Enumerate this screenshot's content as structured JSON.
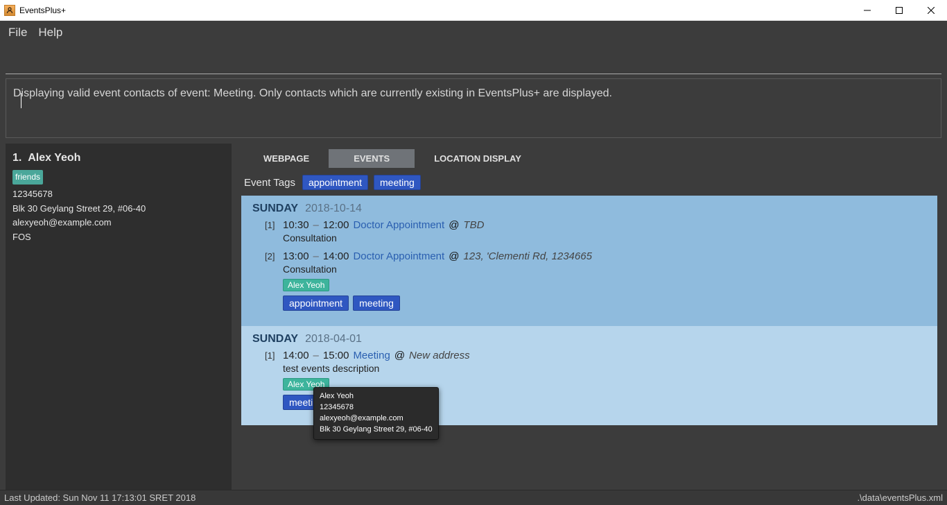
{
  "window": {
    "title": "EventsPlus+"
  },
  "menu": {
    "file": "File",
    "help": "Help"
  },
  "command": {
    "value": "",
    "placeholder": ""
  },
  "message": "Displaying valid event contacts of event: Meeting. Only contacts which are currently existing in EventsPlus+ are displayed.",
  "contact": {
    "index": "1.",
    "name": "Alex Yeoh",
    "tag": "friends",
    "phone": "12345678",
    "address": "Blk 30 Geylang Street 29, #06-40",
    "email": "alexyeoh@example.com",
    "fos": "FOS"
  },
  "tabs": {
    "webpage": "WEBPAGE",
    "events": "EVENTS",
    "location": "LOCATION DISPLAY"
  },
  "event_tags": {
    "label": "Event Tags",
    "items": [
      "appointment",
      "meeting"
    ]
  },
  "days": [
    {
      "dow": "SUNDAY",
      "date": "2018-10-14",
      "events": [
        {
          "idx": "[1]",
          "start": "10:30",
          "dash": "–",
          "end": "12:00",
          "title": "Doctor Appointment",
          "at": "@",
          "loc": "TBD",
          "desc": "Consultation",
          "people": [],
          "tags": []
        },
        {
          "idx": "[2]",
          "start": "13:00",
          "dash": "–",
          "end": "14:00",
          "title": "Doctor Appointment",
          "at": "@",
          "loc": "123, 'Clementi Rd, 1234665",
          "desc": "Consultation",
          "people": [
            "Alex Yeoh"
          ],
          "tags": [
            "appointment",
            "meeting"
          ]
        }
      ]
    },
    {
      "dow": "SUNDAY",
      "date": "2018-04-01",
      "events": [
        {
          "idx": "[1]",
          "start": "14:00",
          "dash": "–",
          "end": "15:00",
          "title": "Meeting",
          "at": "@",
          "loc": "New address",
          "desc": "test events description",
          "people": [
            "Alex Yeoh"
          ],
          "tags": [
            "meeting"
          ]
        }
      ]
    }
  ],
  "tooltip": {
    "name": "Alex Yeoh",
    "phone": "12345678",
    "email": "alexyeoh@example.com",
    "address": "Blk 30 Geylang Street 29, #06-40"
  },
  "footer": {
    "left": "Last Updated: Sun Nov 11 17:13:01 SRET 2018",
    "right": ".\\data\\eventsPlus.xml"
  }
}
